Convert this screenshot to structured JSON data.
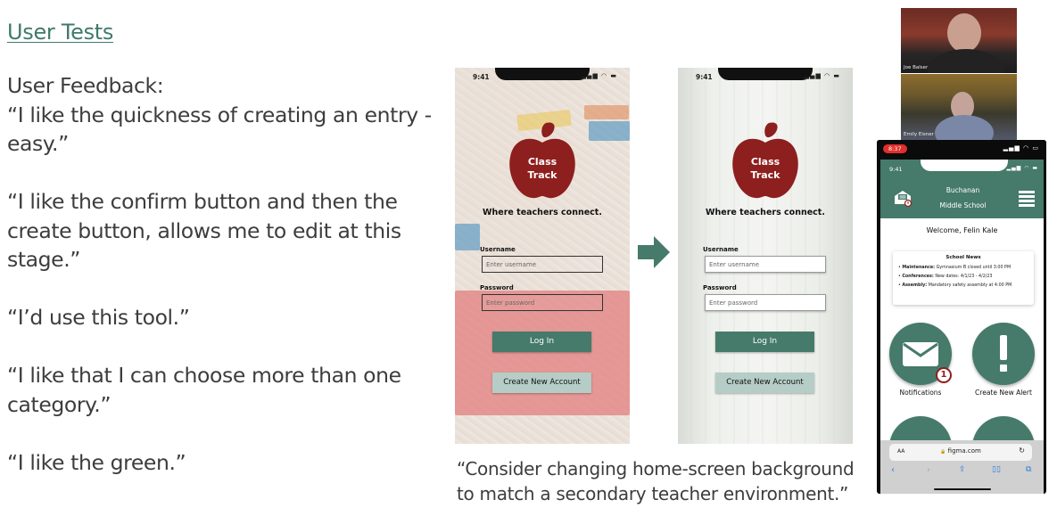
{
  "slide": {
    "title": "User Tests",
    "feedback_heading": "User Feedback:",
    "quotes": [
      [
        "“I like the quickness of creating an entry -",
        "easy.”"
      ],
      [
        "“I like the confirm button and then the",
        "create button, allows me to edit at this",
        "stage.”"
      ],
      [
        "“I’d use this tool.”"
      ],
      [
        "“I like that I can choose more than one",
        "category.”"
      ],
      [
        "“I like the green.”"
      ]
    ],
    "caption": [
      "“Consider changing home-screen background",
      "to match a secondary teacher environment.”"
    ],
    "accent_color": "#3f7a6a"
  },
  "login_mockups": [
    {
      "variant": "before",
      "background": "playground-mulch",
      "status_time": "9:41",
      "logo_text": [
        "Class",
        "Track"
      ],
      "tagline": "Where teachers connect.",
      "username_label": "Username",
      "username_placeholder": "Enter username",
      "password_label": "Password",
      "password_placeholder": "Enter password",
      "login_button": "Log In",
      "create_account_button": "Create New Account"
    },
    {
      "variant": "after",
      "background": "school-hallway",
      "status_time": "9:41",
      "logo_text": [
        "Class",
        "Track"
      ],
      "tagline": "Where teachers connect.",
      "username_label": "Username",
      "username_placeholder": "Enter username",
      "password_label": "Password",
      "password_placeholder": "Enter password",
      "login_button": "Log In",
      "create_account_button": "Create New Account"
    }
  ],
  "arrow_icon": "right-arrow",
  "video_call": {
    "participants": [
      {
        "name": "Joe Balser"
      },
      {
        "name": "Emily Eisner"
      }
    ]
  },
  "recorded_phone": {
    "recording_time": "8:37",
    "app_status_time": "9:41",
    "school_name": [
      "Buchanan",
      "Middle School"
    ],
    "welcome": "Welcome, Felin Kale",
    "news": {
      "title": "School News",
      "items": [
        {
          "label": "Maintenance:",
          "text": " Gymnasium B closed until 3:00 PM"
        },
        {
          "label": "Conferences:",
          "text": " New dates: 4/1/23 - 4/2/23"
        },
        {
          "label": "Assembly:",
          "text": " Mandatory safety assembly at 4:00 PM"
        }
      ]
    },
    "tiles": [
      {
        "label": "Notifications",
        "icon": "envelope",
        "badge": "1"
      },
      {
        "label": "Create New Alert",
        "icon": "exclamation"
      }
    ],
    "header_badge": "1",
    "browser": {
      "text_size": "AA",
      "url": "figma.com",
      "lock_icon": "🔒",
      "reload_icon": "↻",
      "nav": {
        "back": "‹",
        "forward": "›",
        "share": "⇪",
        "bookmarks": "📖",
        "tabs": "⧉"
      }
    }
  },
  "colors": {
    "brand_green": "#467a6a",
    "light_green": "#b5cdc6",
    "apple_red": "#8e1f1f",
    "recording_red": "#e0302b"
  }
}
